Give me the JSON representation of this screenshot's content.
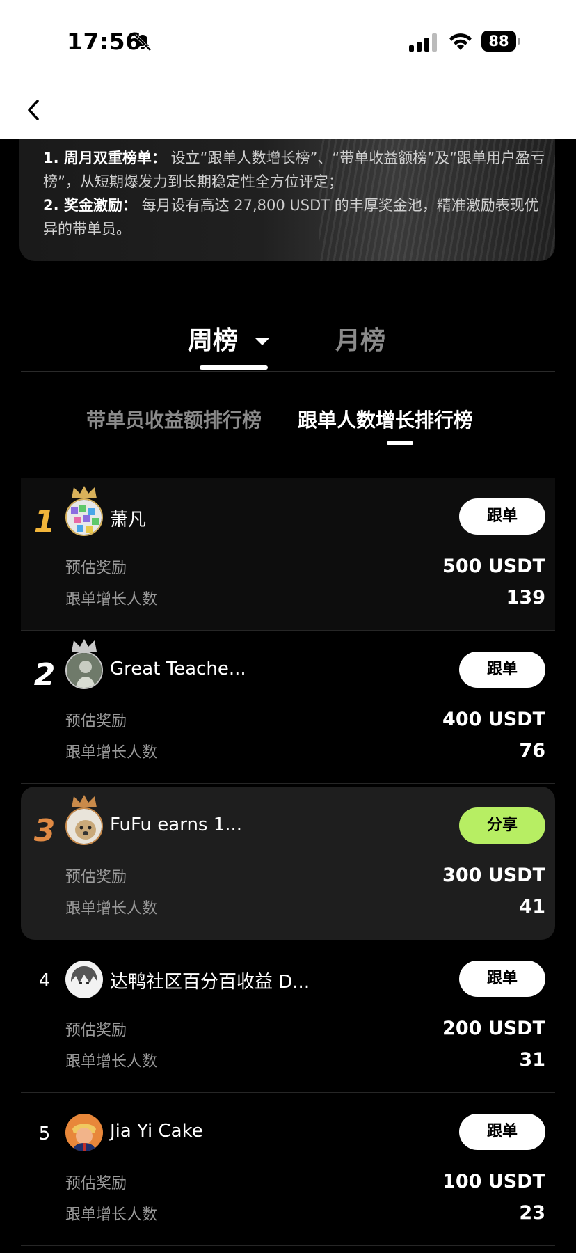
{
  "status_bar": {
    "time": "17:56",
    "battery": "88"
  },
  "intro": {
    "line1_bold": "1. 周月双重榜单：",
    "line1_text": "设立“跟单人数增长榜”、“带单收益额榜”及“跟单用户盈亏榜”，从短期爆发力到长期稳定性全方位评定；",
    "line2_bold": "2. 奖金激励：",
    "line2_text": "每月设有高达 27,800 USDT 的丰厚奖金池，精准激励表现优异的带单员。"
  },
  "period_tabs": {
    "week": "周榜",
    "month": "月榜"
  },
  "sub_tabs": {
    "income": "带单员收益额排行榜",
    "followers": "跟单人数增长排行榜"
  },
  "labels": {
    "reward": "预估奖励",
    "growth": "跟单增长人数"
  },
  "items": [
    {
      "rank": "1",
      "name": "萧凡",
      "action": "跟单",
      "reward": "500 USDT",
      "growth": "139"
    },
    {
      "rank": "2",
      "name": "Great Teache...",
      "action": "跟单",
      "reward": "400 USDT",
      "growth": "76"
    },
    {
      "rank": "3",
      "name": "FuFu earns 1...",
      "action": "分享",
      "reward": "300 USDT",
      "growth": "41"
    },
    {
      "rank": "4",
      "name": "达鸭社区百分百收益 D...",
      "action": "跟单",
      "reward": "200 USDT",
      "growth": "31"
    },
    {
      "rank": "5",
      "name": "Jia Yi Cake",
      "action": "跟单",
      "reward": "100 USDT",
      "growth": "23"
    }
  ],
  "colors": {
    "share_button": "#b7ee63",
    "rank1": "#f2b53a",
    "rank3": "#e08a44"
  }
}
